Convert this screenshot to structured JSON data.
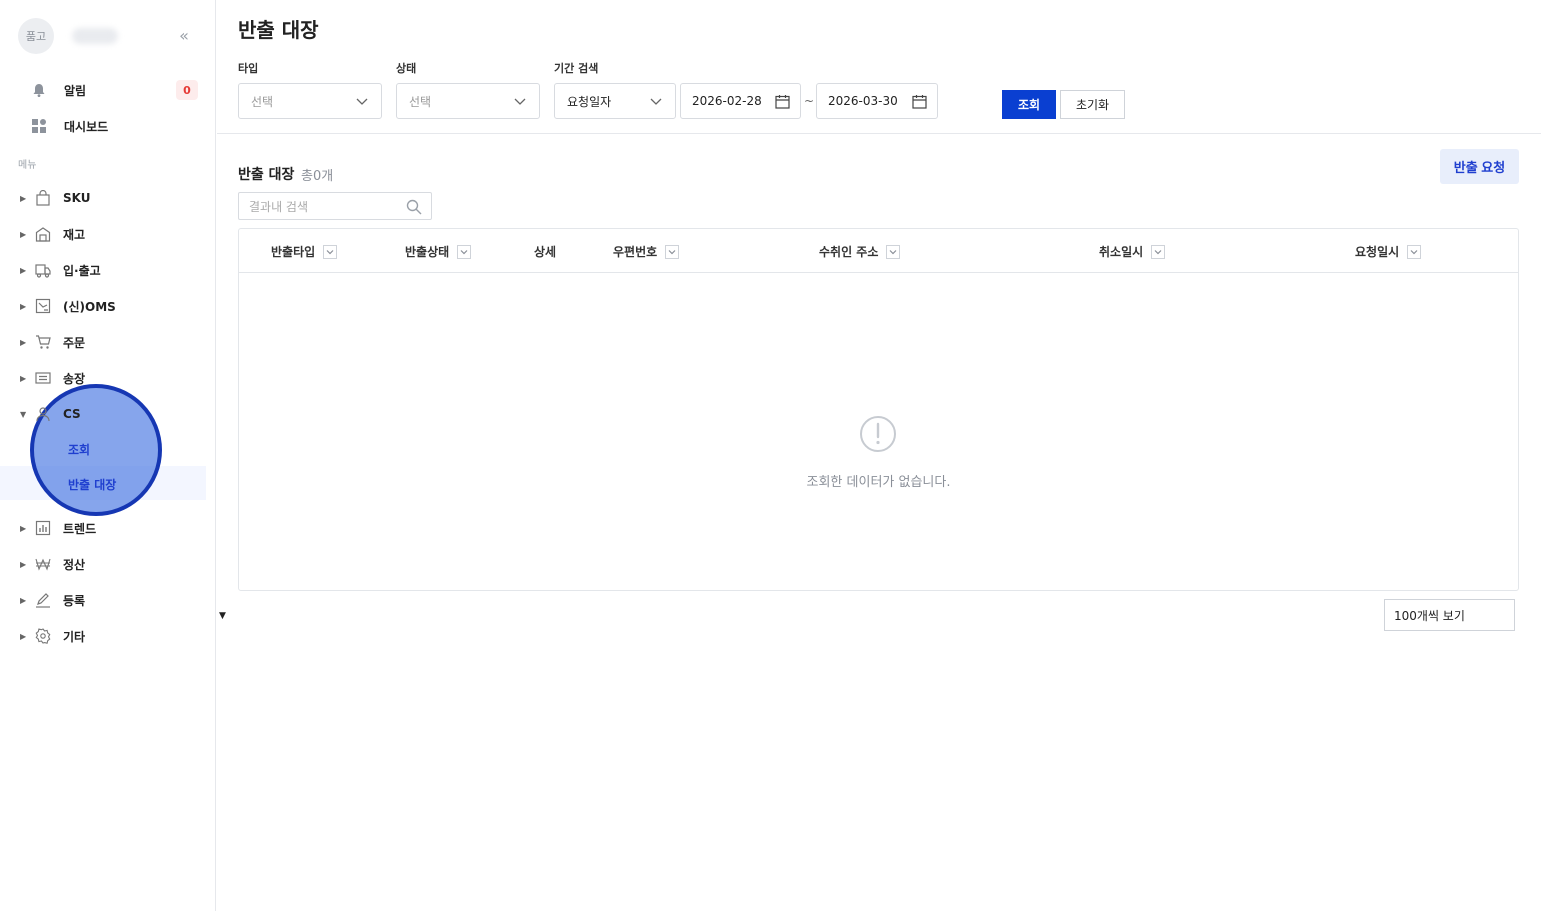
{
  "sidebar": {
    "brand": "품고",
    "collapse_icon": "double-chevron-left-icon",
    "top_items": [
      {
        "label": "알림",
        "icon": "bell-icon",
        "badge": "0"
      },
      {
        "label": "대시보드",
        "icon": "dashboard-icon"
      }
    ],
    "section_label": "메뉴",
    "menu": [
      {
        "label": "SKU",
        "icon": "bag-icon"
      },
      {
        "label": "재고",
        "icon": "warehouse-icon"
      },
      {
        "label": "입·출고",
        "icon": "truck-icon"
      },
      {
        "label": "(신)OMS",
        "icon": "oms-icon"
      },
      {
        "label": "주문",
        "icon": "cart-icon"
      },
      {
        "label": "송장",
        "icon": "invoice-icon"
      },
      {
        "label": "CS",
        "icon": "person-icon",
        "expanded": true,
        "children": [
          {
            "label": "조회"
          },
          {
            "label": "반출 대장",
            "active": true
          }
        ]
      },
      {
        "label": "트렌드",
        "icon": "chart-icon"
      },
      {
        "label": "정산",
        "icon": "won-icon"
      },
      {
        "label": "등록",
        "icon": "pencil-icon"
      },
      {
        "label": "기타",
        "icon": "gear-icon"
      }
    ],
    "highlight_color": "#1637b3"
  },
  "main": {
    "title": "반출 대장",
    "filters": {
      "type_label": "타입",
      "type_placeholder": "선택",
      "status_label": "상태",
      "status_placeholder": "선택",
      "period_label": "기간 검색",
      "period_type": "요청일자",
      "date_from": "2026-02-28",
      "date_sep": "~",
      "date_to": "2026-03-30",
      "search_button": "조회",
      "reset_button": "초기화"
    },
    "list": {
      "title": "반출 대장",
      "count": "총0개",
      "request_button": "반출 요청",
      "search_placeholder": "결과내 검색",
      "columns": [
        "반출타입",
        "반출상태",
        "상세",
        "우편번호",
        "수취인 주소",
        "취소일시",
        "요청일시"
      ],
      "empty_message": "조회한 데이터가 없습니다.",
      "page_size": "100개씩 보기"
    },
    "accent_color": "#0a3fd1"
  }
}
